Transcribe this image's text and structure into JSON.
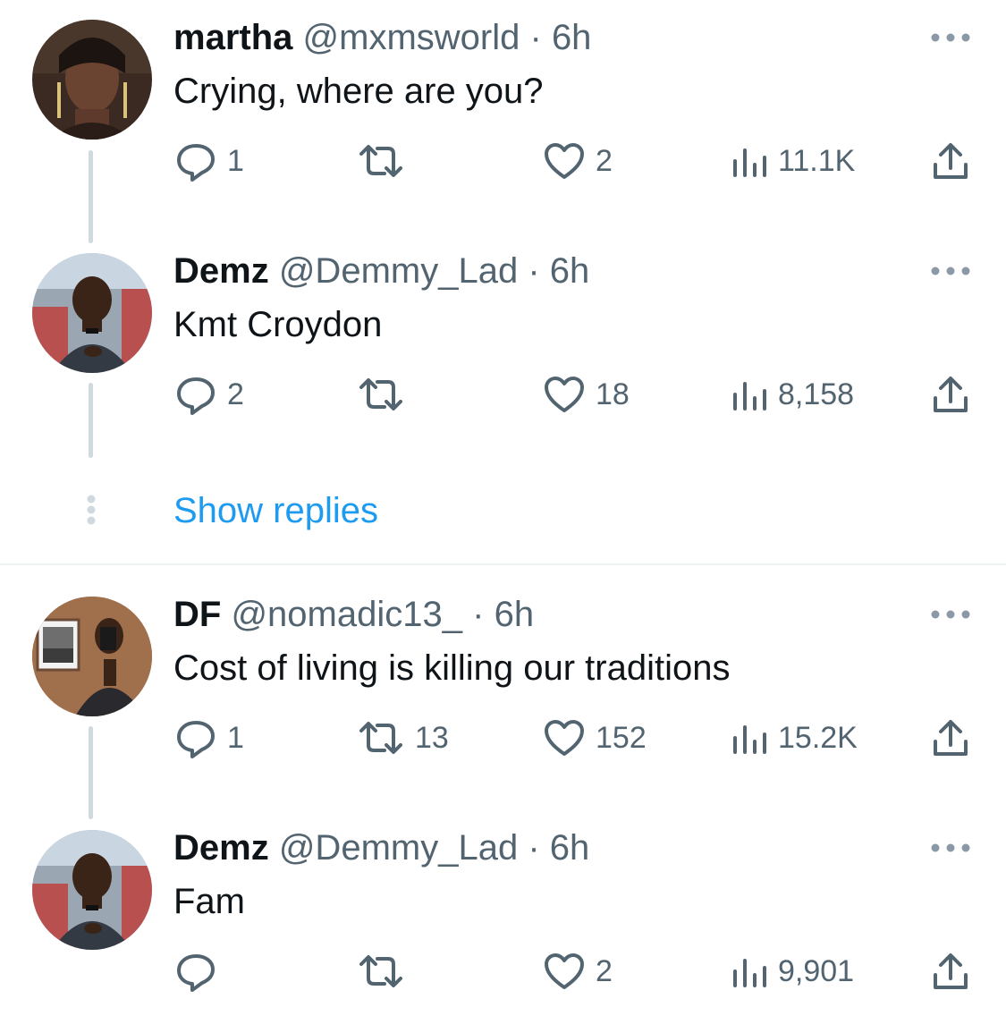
{
  "tweets": [
    {
      "name": "martha",
      "handle": "@mxmsworld",
      "dot": "·",
      "time": "6h",
      "text": "Crying, where are you?",
      "replies": "1",
      "retweets": "",
      "likes": "2",
      "views": "11.1K",
      "avatar": "woman-portrait-avatar"
    },
    {
      "name": "Demz",
      "handle": "@Demmy_Lad",
      "dot": "·",
      "time": "6h",
      "text": "Kmt Croydon",
      "replies": "2",
      "retweets": "",
      "likes": "18",
      "views": "8,158",
      "avatar": "man-suit-avatar"
    },
    {
      "name": "DF",
      "handle": "@nomadic13_",
      "dot": "·",
      "time": "6h",
      "text": "Cost of living is killing our traditions",
      "replies": "1",
      "retweets": "13",
      "likes": "152",
      "views": "15.2K",
      "avatar": "mirror-selfie-avatar"
    },
    {
      "name": "Demz",
      "handle": "@Demmy_Lad",
      "dot": "·",
      "time": "6h",
      "text": "Fam",
      "replies": "",
      "retweets": "",
      "likes": "2",
      "views": "9,901",
      "avatar": "man-suit-avatar"
    }
  ],
  "show_replies_label": "Show replies",
  "colors": {
    "text": "#0f1419",
    "secondary": "#536471",
    "link": "#1d9bf0",
    "thread_line": "#cfd9de",
    "divider": "#eff3f4"
  },
  "icons": [
    "reply-icon",
    "retweet-icon",
    "like-icon",
    "views-icon",
    "share-icon",
    "more-options-icon"
  ]
}
